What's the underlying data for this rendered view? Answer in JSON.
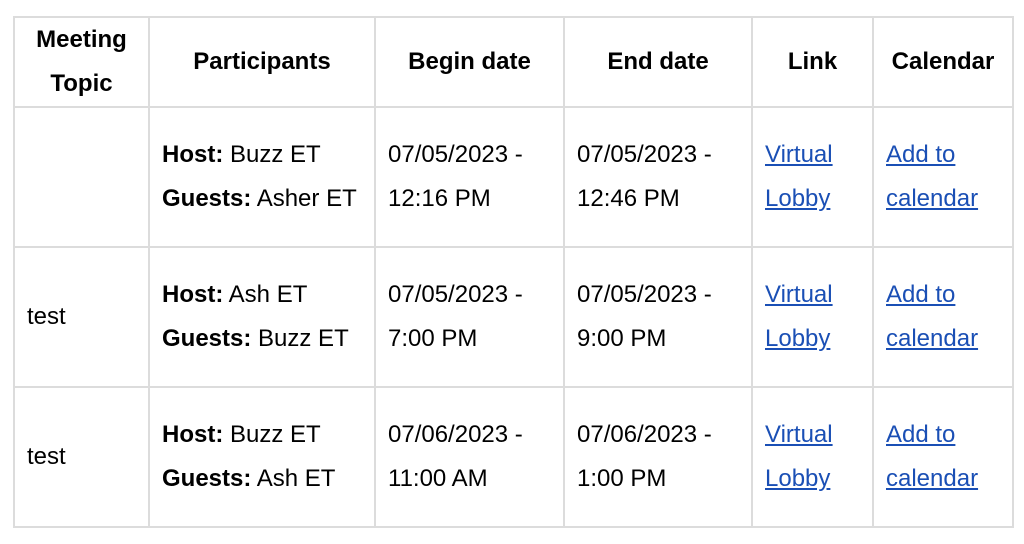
{
  "table": {
    "headers": [
      "Meeting Topic",
      "Participants",
      "Begin date",
      "End date",
      "Link",
      "Calendar"
    ],
    "host_label": "Host:",
    "guests_label": "Guests:",
    "link_color": "#1a4fb5",
    "rows": [
      {
        "topic": "",
        "host": "Buzz ET",
        "guests": "Asher ET",
        "begin": "07/05/2023 - 12:16 PM",
        "end": "07/05/2023 - 12:46 PM",
        "link": "Virtual Lobby",
        "calendar": "Add to calendar"
      },
      {
        "topic": "test",
        "host": "Ash ET",
        "guests": "Buzz ET",
        "begin": "07/05/2023 - 7:00 PM",
        "end": "07/05/2023 - 9:00 PM",
        "link": "Virtual Lobby",
        "calendar": "Add to calendar"
      },
      {
        "topic": "test",
        "host": "Buzz ET",
        "guests": "Ash ET",
        "begin": "07/06/2023 - 11:00 AM",
        "end": "07/06/2023 - 1:00 PM",
        "link": "Virtual Lobby",
        "calendar": "Add to calendar"
      }
    ]
  }
}
